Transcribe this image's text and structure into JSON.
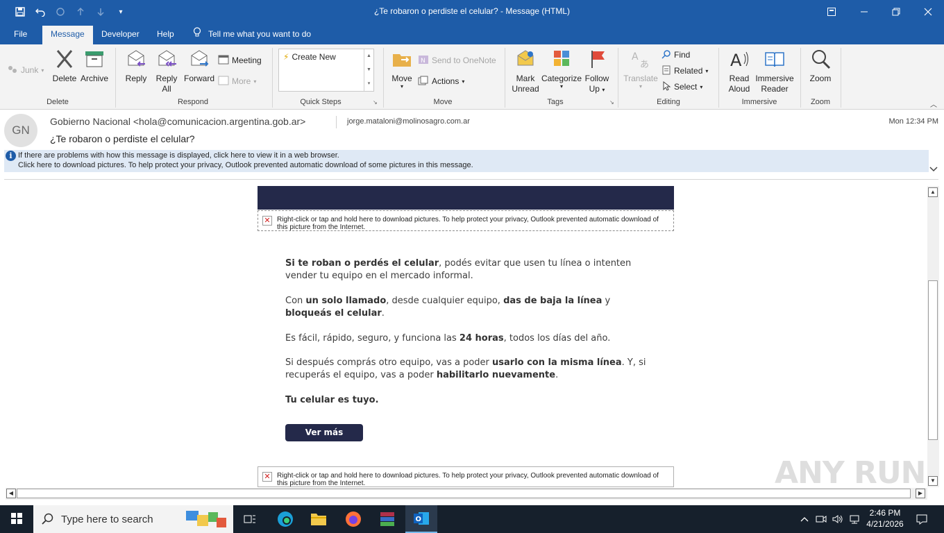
{
  "window": {
    "title": "¿Te robaron o perdiste el celular?  -  Message (HTML)"
  },
  "menu_tabs": [
    {
      "label": "File",
      "active": false
    },
    {
      "label": "Message",
      "active": true
    },
    {
      "label": "Developer",
      "active": false
    },
    {
      "label": "Help",
      "active": false
    },
    {
      "label": "Tell me what you want to do",
      "active": false
    }
  ],
  "ribbon": {
    "delete_group": {
      "label": "Delete",
      "junk": "Junk",
      "delete": "Delete",
      "archive": "Archive"
    },
    "respond_group": {
      "label": "Respond",
      "reply": "Reply",
      "reply_all_1": "Reply",
      "reply_all_2": "All",
      "forward": "Forward",
      "meeting": "Meeting",
      "more": "More"
    },
    "quicksteps_group": {
      "label": "Quick Steps",
      "create_new": "Create New"
    },
    "move_group": {
      "label": "Move",
      "move": "Move",
      "send_onenote": "Send to OneNote",
      "actions": "Actions"
    },
    "tags_group": {
      "label": "Tags",
      "mark_unread_1": "Mark",
      "mark_unread_2": "Unread",
      "categorize": "Categorize",
      "follow_up_1": "Follow",
      "follow_up_2": "Up"
    },
    "editing_group": {
      "label": "Editing",
      "translate": "Translate",
      "find": "Find",
      "related": "Related",
      "select": "Select"
    },
    "immersive_group": {
      "label": "Immersive",
      "read_aloud_1": "Read",
      "read_aloud_2": "Aloud",
      "immersive_reader_1": "Immersive",
      "immersive_reader_2": "Reader"
    },
    "zoom_group": {
      "label": "Zoom",
      "zoom": "Zoom"
    }
  },
  "message": {
    "avatar_initials": "GN",
    "sender": "Gobierno Nacional <hola@comunicacion.argentina.gob.ar>",
    "recipient": "jorge.mataloni@molinosagro.com.ar",
    "date": "Mon 12:34 PM",
    "subject": "¿Te robaron o perdiste el celular?",
    "info_line1": "If there are problems with how this message is displayed, click here to view it in a web browser.",
    "info_line2": "Click here to download pictures. To help protect your privacy, Outlook prevented automatic download of some pictures in this message."
  },
  "email_body": {
    "picture_placeholder": "Right-click or tap and hold here to download pictures. To help protect your privacy, Outlook prevented automatic download of this picture from the Internet.",
    "p1_b1": "Si te roban o perdés el celular",
    "p1_t1": ", podés evitar que usen tu línea o intenten vender tu equipo en el mercado informal.",
    "p2_t1": "Con ",
    "p2_b1": "un solo llamado",
    "p2_t2": ", desde cualquier equipo, ",
    "p2_b2": "das de baja la línea",
    "p2_t3": " y ",
    "p2_b3": "bloqueás el celular",
    "p2_t4": ".",
    "p3_t1": "Es fácil, rápido, seguro, y funciona las ",
    "p3_b1": "24 horas",
    "p3_t2": ", todos los días del año.",
    "p4_t1": "Si después comprás otro equipo, vas a poder ",
    "p4_b1": "usarlo con la misma línea",
    "p4_t2": ". Y, si recuperás el equipo, vas a poder ",
    "p4_b2": "habilitarlo nuevamente",
    "p4_t3": ".",
    "p5_b1": "Tu celular es tuyo.",
    "button": "Ver más"
  },
  "watermark": "ANY RUN",
  "taskbar": {
    "search_placeholder": "Type here to search",
    "time": "2:46 PM",
    "date": "4/21/2026"
  },
  "colors": {
    "accent": "#1e5ca8",
    "email_dark": "#24294a",
    "taskbar": "#16202c"
  }
}
